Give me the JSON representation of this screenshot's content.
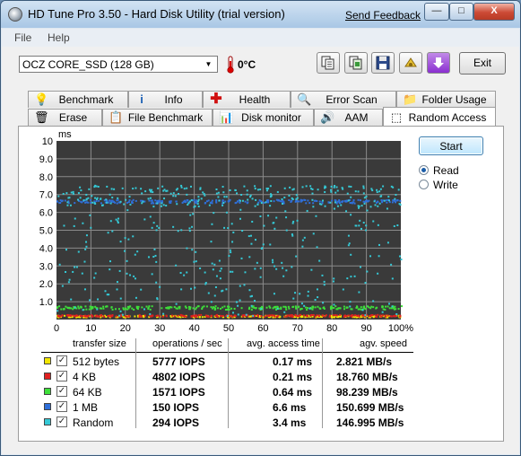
{
  "window": {
    "title": "HD Tune Pro 3.50 - Hard Disk Utility (trial version)",
    "send_feedback": "Send Feedback",
    "minimize_glyph": "—",
    "maximize_glyph": "□",
    "close_glyph": "X"
  },
  "menu": {
    "file": "File",
    "help": "Help"
  },
  "toolbar": {
    "drive": "OCZ CORE_SSD (128 GB)",
    "temperature": "0°C",
    "buttons": [
      "copy-info-icon",
      "copy-screenshot-icon",
      "save-icon",
      "options-icon",
      "download-icon"
    ],
    "exit": "Exit"
  },
  "tabs": {
    "row1": [
      "Benchmark",
      "Info",
      "Health",
      "Error Scan",
      "Folder Usage"
    ],
    "row2": [
      "Erase",
      "File Benchmark",
      "Disk monitor",
      "AAM",
      "Random Access"
    ],
    "active": "Random Access"
  },
  "controls": {
    "start": "Start",
    "read": "Read",
    "write": "Write",
    "selected_mode": "Read"
  },
  "chart_data": {
    "type": "scatter",
    "ylabel": "ms",
    "ylim": [
      0,
      10
    ],
    "xlim": [
      0,
      100
    ],
    "y_ticks": [
      "10",
      "9.0",
      "8.0",
      "7.0",
      "6.0",
      "5.0",
      "4.0",
      "3.0",
      "2.0",
      "1.0"
    ],
    "x_ticks": [
      "0",
      "10",
      "20",
      "30",
      "40",
      "50",
      "60",
      "70",
      "80",
      "90",
      "100%"
    ],
    "grid": true,
    "background": "#3a3a3a",
    "series": [
      {
        "name": "512 bytes",
        "color": "#f2e600",
        "band": [
          0.12,
          0.22
        ],
        "scatter": false
      },
      {
        "name": "4 KB",
        "color": "#e02020",
        "band": [
          0.16,
          0.26
        ],
        "scatter": false
      },
      {
        "name": "64 KB",
        "color": "#3ee03a",
        "band": [
          0.55,
          0.75
        ],
        "scatter": false
      },
      {
        "name": "1 MB",
        "color": "#2f6fd9",
        "band": [
          6.5,
          6.7
        ],
        "scatter": false
      },
      {
        "name": "Random",
        "color": "#35c9d6",
        "band": [
          0.2,
          7.5
        ],
        "scatter": true
      }
    ]
  },
  "table": {
    "headers": [
      "transfer size",
      "operations / sec",
      "avg. access time",
      "agv. speed"
    ],
    "rows": [
      {
        "color": "#f2e600",
        "checked": "✓",
        "size": "512 bytes",
        "ops": "5777 IOPS",
        "access": "0.17 ms",
        "speed": "2.821 MB/s"
      },
      {
        "color": "#e02020",
        "checked": "✓",
        "size": "4 KB",
        "ops": "4802 IOPS",
        "access": "0.21 ms",
        "speed": "18.760 MB/s"
      },
      {
        "color": "#3ee03a",
        "checked": "✓",
        "size": "64 KB",
        "ops": "1571 IOPS",
        "access": "0.64 ms",
        "speed": "98.239 MB/s"
      },
      {
        "color": "#2f6fd9",
        "checked": "✓",
        "size": "1 MB",
        "ops": "150 IOPS",
        "access": "6.6 ms",
        "speed": "150.699 MB/s"
      },
      {
        "color": "#35c9d6",
        "checked": "✓",
        "size": "Random",
        "ops": "294 IOPS",
        "access": "3.4 ms",
        "speed": "146.995 MB/s"
      }
    ]
  }
}
